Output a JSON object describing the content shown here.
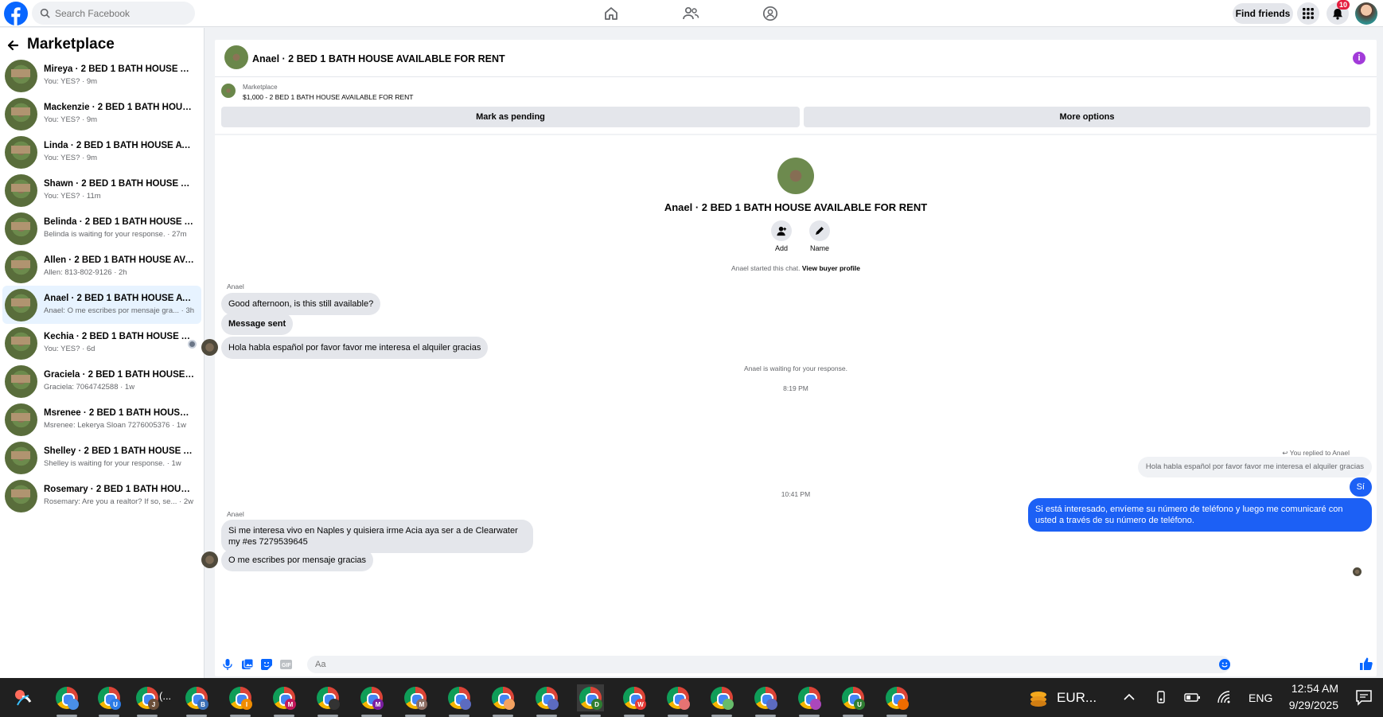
{
  "topbar": {
    "search_placeholder": "Search Facebook",
    "find_friends": "Find friends",
    "notification_count": "10"
  },
  "sidebar": {
    "title": "Marketplace",
    "conversations": [
      {
        "name": "Mireya · 2 BED 1 BATH HOUSE AVA...",
        "preview": "You: YES? · 9m"
      },
      {
        "name": "Mackenzie · 2 BED 1 BATH HOUSE ...",
        "preview": "You: YES? · 9m"
      },
      {
        "name": "Linda · 2 BED 1 BATH HOUSE AVAI...",
        "preview": "You: YES? · 9m"
      },
      {
        "name": "Shawn · 2 BED 1 BATH HOUSE AVA...",
        "preview": "You: YES? · 11m"
      },
      {
        "name": "Belinda · 2 BED 1 BATH HOUSE AV...",
        "preview": "Belinda is waiting for your response. · 27m"
      },
      {
        "name": "Allen · 2 BED 1 BATH HOUSE AVAIL...",
        "preview": "Allen: 813-802-9126 · 2h"
      },
      {
        "name": "Anael · 2 BED 1 BATH HOUSE AVAI...",
        "preview": "Anael: O me escribes por mensaje gra... · 3h"
      },
      {
        "name": "Kechia · 2 BED 1 BATH HOUSE A...",
        "preview": "You: YES? · 6d"
      },
      {
        "name": "Graciela · 2 BED 1 BATH HOUSE AV...",
        "preview": "Graciela: 7064742588 · 1w"
      },
      {
        "name": "Msrenee · 2 BED 1 BATH HOUSE A...",
        "preview": "Msrenee: Lekerya Sloan 7276005376 · 1w"
      },
      {
        "name": "Shelley · 2 BED 1 BATH HOUSE AV...",
        "preview": "Shelley is waiting for your response. · 1w"
      },
      {
        "name": "Rosemary · 2 BED 1 BATH HOUSE ...",
        "preview": "Rosemary: Are you a realtor? If so, se... · 2w"
      }
    ]
  },
  "chat": {
    "header_title": "Anael · 2 BED 1 BATH HOUSE AVAILABLE FOR RENT",
    "listing_source": "Marketplace",
    "listing_name": "$1,000 - 2 BED 1 BATH HOUSE AVAILABLE FOR RENT",
    "mark_pending": "Mark as pending",
    "more_options": "More options",
    "profile_name": "Anael · 2 BED 1 BATH HOUSE AVAILABLE FOR RENT",
    "add_label": "Add",
    "name_label": "Name",
    "started_text": "Anael started this chat.",
    "view_buyer": "View buyer profile",
    "sender1": "Anael",
    "msg1": "Good afternoon, is this still available?",
    "msg2": "Message sent",
    "msg3": "Hola habla español por favor favor me interesa el alquiler gracias",
    "waiting": "Anael is waiting for your response.",
    "time1": "8:19 PM",
    "replied_to": "You replied to Anael",
    "quoted": "Hola habla español por favor favor me interesa el alquiler gracias",
    "out1": "Sí",
    "out2": "Si está interesado, envíeme su número de teléfono y luego me comunicaré con usted a través de su número de teléfono.",
    "time2": "10:41 PM",
    "sender2": "Anael",
    "msg4": "Si me interesa vivo en Naples y quisiera irme Acia aya ser a de Clearwater my #es 7279539645",
    "msg5": "O me escribes por mensaje gracias",
    "input_placeholder": "Aa"
  },
  "taskbar": {
    "apps": [
      "",
      "U",
      "J",
      "B",
      "I",
      "M",
      "",
      "M",
      "M",
      "",
      "",
      "",
      "D",
      "W",
      "",
      "",
      "",
      "",
      "U",
      ""
    ],
    "app4_suffix": "(...",
    "weather": "EUR...",
    "lang": "ENG",
    "time": "12:54 AM",
    "date": "9/29/2025"
  },
  "colors": {
    "accent": "#0866ff",
    "outgoing_bubble": "#1c60f5",
    "info": "#a23bd9"
  }
}
